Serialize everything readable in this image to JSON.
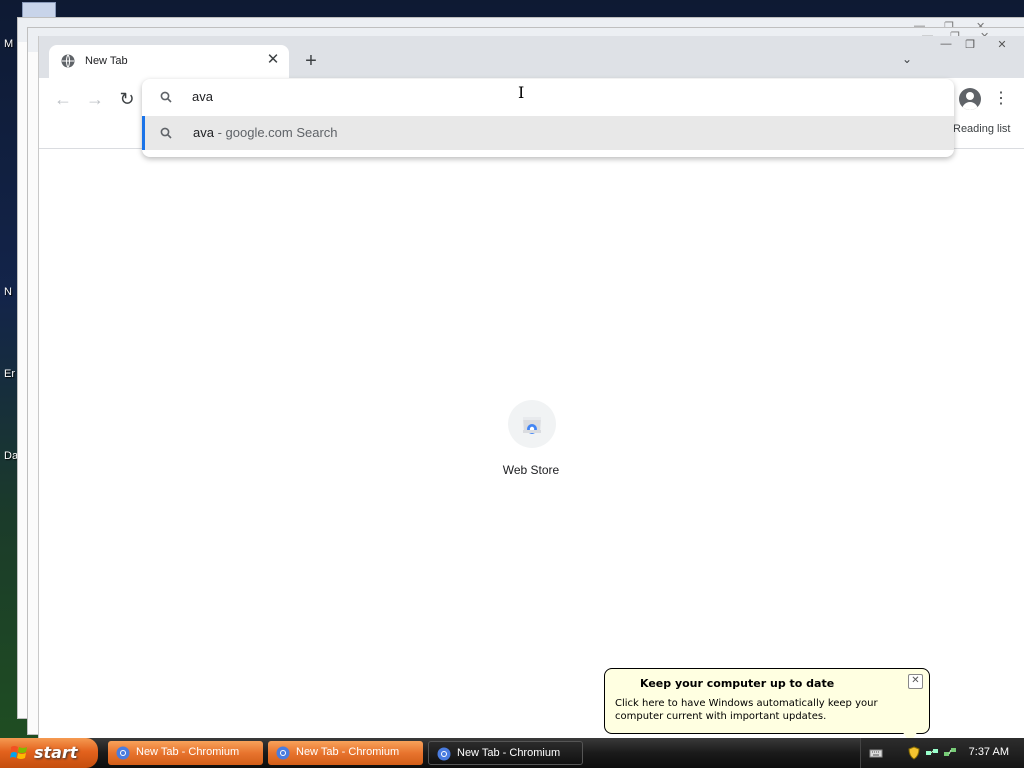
{
  "desktop": {
    "fragments": [
      "M",
      "N",
      "Er",
      "Da"
    ]
  },
  "browser": {
    "tab": {
      "title": "New Tab",
      "close": "✕"
    },
    "newtab_label": "+",
    "tabsearch_label": "⌄",
    "window_controls": [
      "—",
      "❐",
      "✕"
    ],
    "nav": {
      "back": "←",
      "forward": "→",
      "reload": "↻"
    },
    "menu_label": "⋮",
    "reading_list": "Reading list"
  },
  "omnibox": {
    "input_value": "ava",
    "suggestion": {
      "query": "ava",
      "suffix": " - google.com Search"
    }
  },
  "ntp": {
    "shortcut_label": "Web Store"
  },
  "balloon": {
    "title": "Keep your computer up to date",
    "body": "Click here to have Windows automatically keep your computer current with important updates.",
    "close": "✕"
  },
  "taskbar": {
    "start_label": "start",
    "buttons": [
      {
        "label": "New Tab - Chromium",
        "state": "inactive"
      },
      {
        "label": "New Tab - Chromium",
        "state": "inactive"
      },
      {
        "label": "New Tab - Chromium",
        "state": "active"
      }
    ],
    "clock": "7:37 AM"
  },
  "colors": {
    "accent": "#1a73e8",
    "tabstrip": "#dee1e6",
    "balloon_bg": "#ffffe1",
    "start_orange": "#e3621d"
  }
}
